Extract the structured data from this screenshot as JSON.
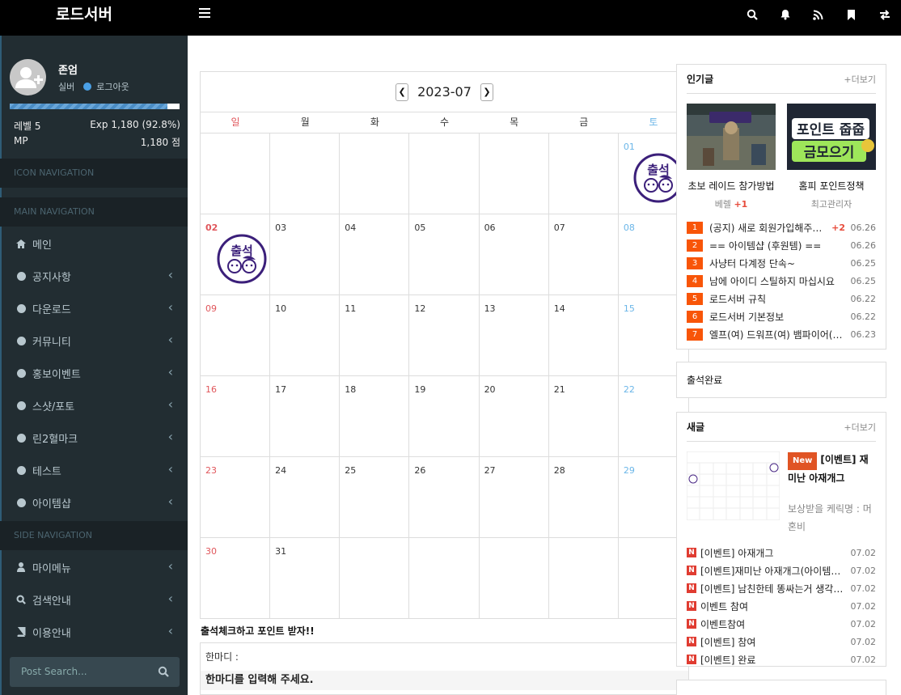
{
  "app": {
    "brand": "로드서버"
  },
  "topbar": {
    "icons": [
      "search-icon",
      "bell-icon",
      "rss-icon",
      "bookmark-icon",
      "exchange-icon"
    ]
  },
  "user": {
    "name": "존엄",
    "rank": "실버",
    "logout": "로그아웃",
    "exp_fraction": 0.928,
    "level_label": "레벨 5",
    "exp_label": "Exp 1,180 (92.8%)",
    "mp_label": "MP",
    "mp_value": "1,180 점"
  },
  "nav": {
    "icon_nav": "ICON NAVIGATION",
    "main_nav": "MAIN NAVIGATION",
    "side_nav": "SIDE NAVIGATION",
    "main_items": [
      {
        "label": "메인",
        "icon": "home-icon"
      },
      {
        "label": "공지사항",
        "icon": "circle-icon"
      },
      {
        "label": "다운로드",
        "icon": "circle-icon"
      },
      {
        "label": "커뮤니티",
        "icon": "circle-icon"
      },
      {
        "label": "홍보이벤트",
        "icon": "circle-icon"
      },
      {
        "label": "스샷/포토",
        "icon": "circle-icon"
      },
      {
        "label": "린2혈마크",
        "icon": "circle-icon"
      },
      {
        "label": "테스트",
        "icon": "circle-icon"
      },
      {
        "label": "아이템샵",
        "icon": "circle-icon"
      }
    ],
    "side_items": [
      {
        "label": "마이메뉴",
        "icon": "user-icon"
      },
      {
        "label": "검색안내",
        "icon": "search-icon"
      },
      {
        "label": "이용안내",
        "icon": "book-icon"
      }
    ],
    "search_placeholder": "Post Search..."
  },
  "calendar": {
    "month": "2023-07",
    "weekdays": [
      "일",
      "월",
      "화",
      "수",
      "목",
      "금",
      "토"
    ],
    "days": [
      "",
      "",
      "",
      "",
      "",
      "",
      "01",
      "02",
      "03",
      "04",
      "05",
      "06",
      "07",
      "08",
      "09",
      "10",
      "11",
      "12",
      "13",
      "14",
      "15",
      "16",
      "17",
      "18",
      "19",
      "20",
      "21",
      "22",
      "23",
      "24",
      "25",
      "26",
      "27",
      "28",
      "29",
      "30",
      "31",
      "",
      "",
      "",
      "",
      ""
    ],
    "stamp_text": "출석",
    "checkin_title": "출석체크하고 포인트 받자!!",
    "comment_label": "한마디 :",
    "comment_prompt": "한마디를 입력해 주세요."
  },
  "popular": {
    "title": "인기글",
    "more": "+더보기",
    "cards": [
      {
        "caption": "초보 레이드 참가방법",
        "author": "베렐",
        "plus": "+1"
      },
      {
        "caption": "홈피 포인트정책",
        "author": "최고관리자",
        "plus": ""
      }
    ],
    "card2_art": "포인트 줍줍 금모으기",
    "list": [
      {
        "rank": "1",
        "text": "(공지) 새로 회원가입해주세요",
        "plus": "+2",
        "date": "06.26"
      },
      {
        "rank": "2",
        "text": "== 아이템샵 (후원템) ==",
        "plus": "",
        "date": "06.26"
      },
      {
        "rank": "3",
        "text": "사냥터 다계정 단속~",
        "plus": "",
        "date": "06.25"
      },
      {
        "rank": "4",
        "text": "남에 아이디 스틸하지 마십시요",
        "plus": "",
        "date": "06.25"
      },
      {
        "rank": "5",
        "text": "로드서버 규칙",
        "plus": "",
        "date": "06.22"
      },
      {
        "rank": "6",
        "text": "로드서버 기본정보",
        "plus": "",
        "date": "06.22"
      },
      {
        "rank": "7",
        "text": "엘프(여) 드워프(여) 뱀파이어(여)",
        "plus": "",
        "date": "06.23"
      }
    ]
  },
  "checkin_done": {
    "text": "출석완료"
  },
  "newposts": {
    "title": "새글",
    "more": "+더보기",
    "featured": {
      "badge": "New",
      "title": "[이벤트] 재미난 아재개그",
      "excerpt": "보상받을 케릭명 : 머혼비"
    },
    "list": [
      {
        "text": "[이벤트] 아재개그",
        "date": "07.02"
      },
      {
        "text": "[이벤트]재미난 아재개그(아이템지급)",
        "date": "07.02"
      },
      {
        "text": "[이벤트] 남친한테 똥싸는거 생각하면",
        "date": "07.02"
      },
      {
        "text": "이벤트 참여",
        "date": "07.02"
      },
      {
        "text": "이벤트참여",
        "date": "07.02"
      },
      {
        "text": "[이벤트] 참여",
        "date": "07.02"
      },
      {
        "text": "[이벤트] 완료",
        "date": "07.02"
      }
    ]
  }
}
